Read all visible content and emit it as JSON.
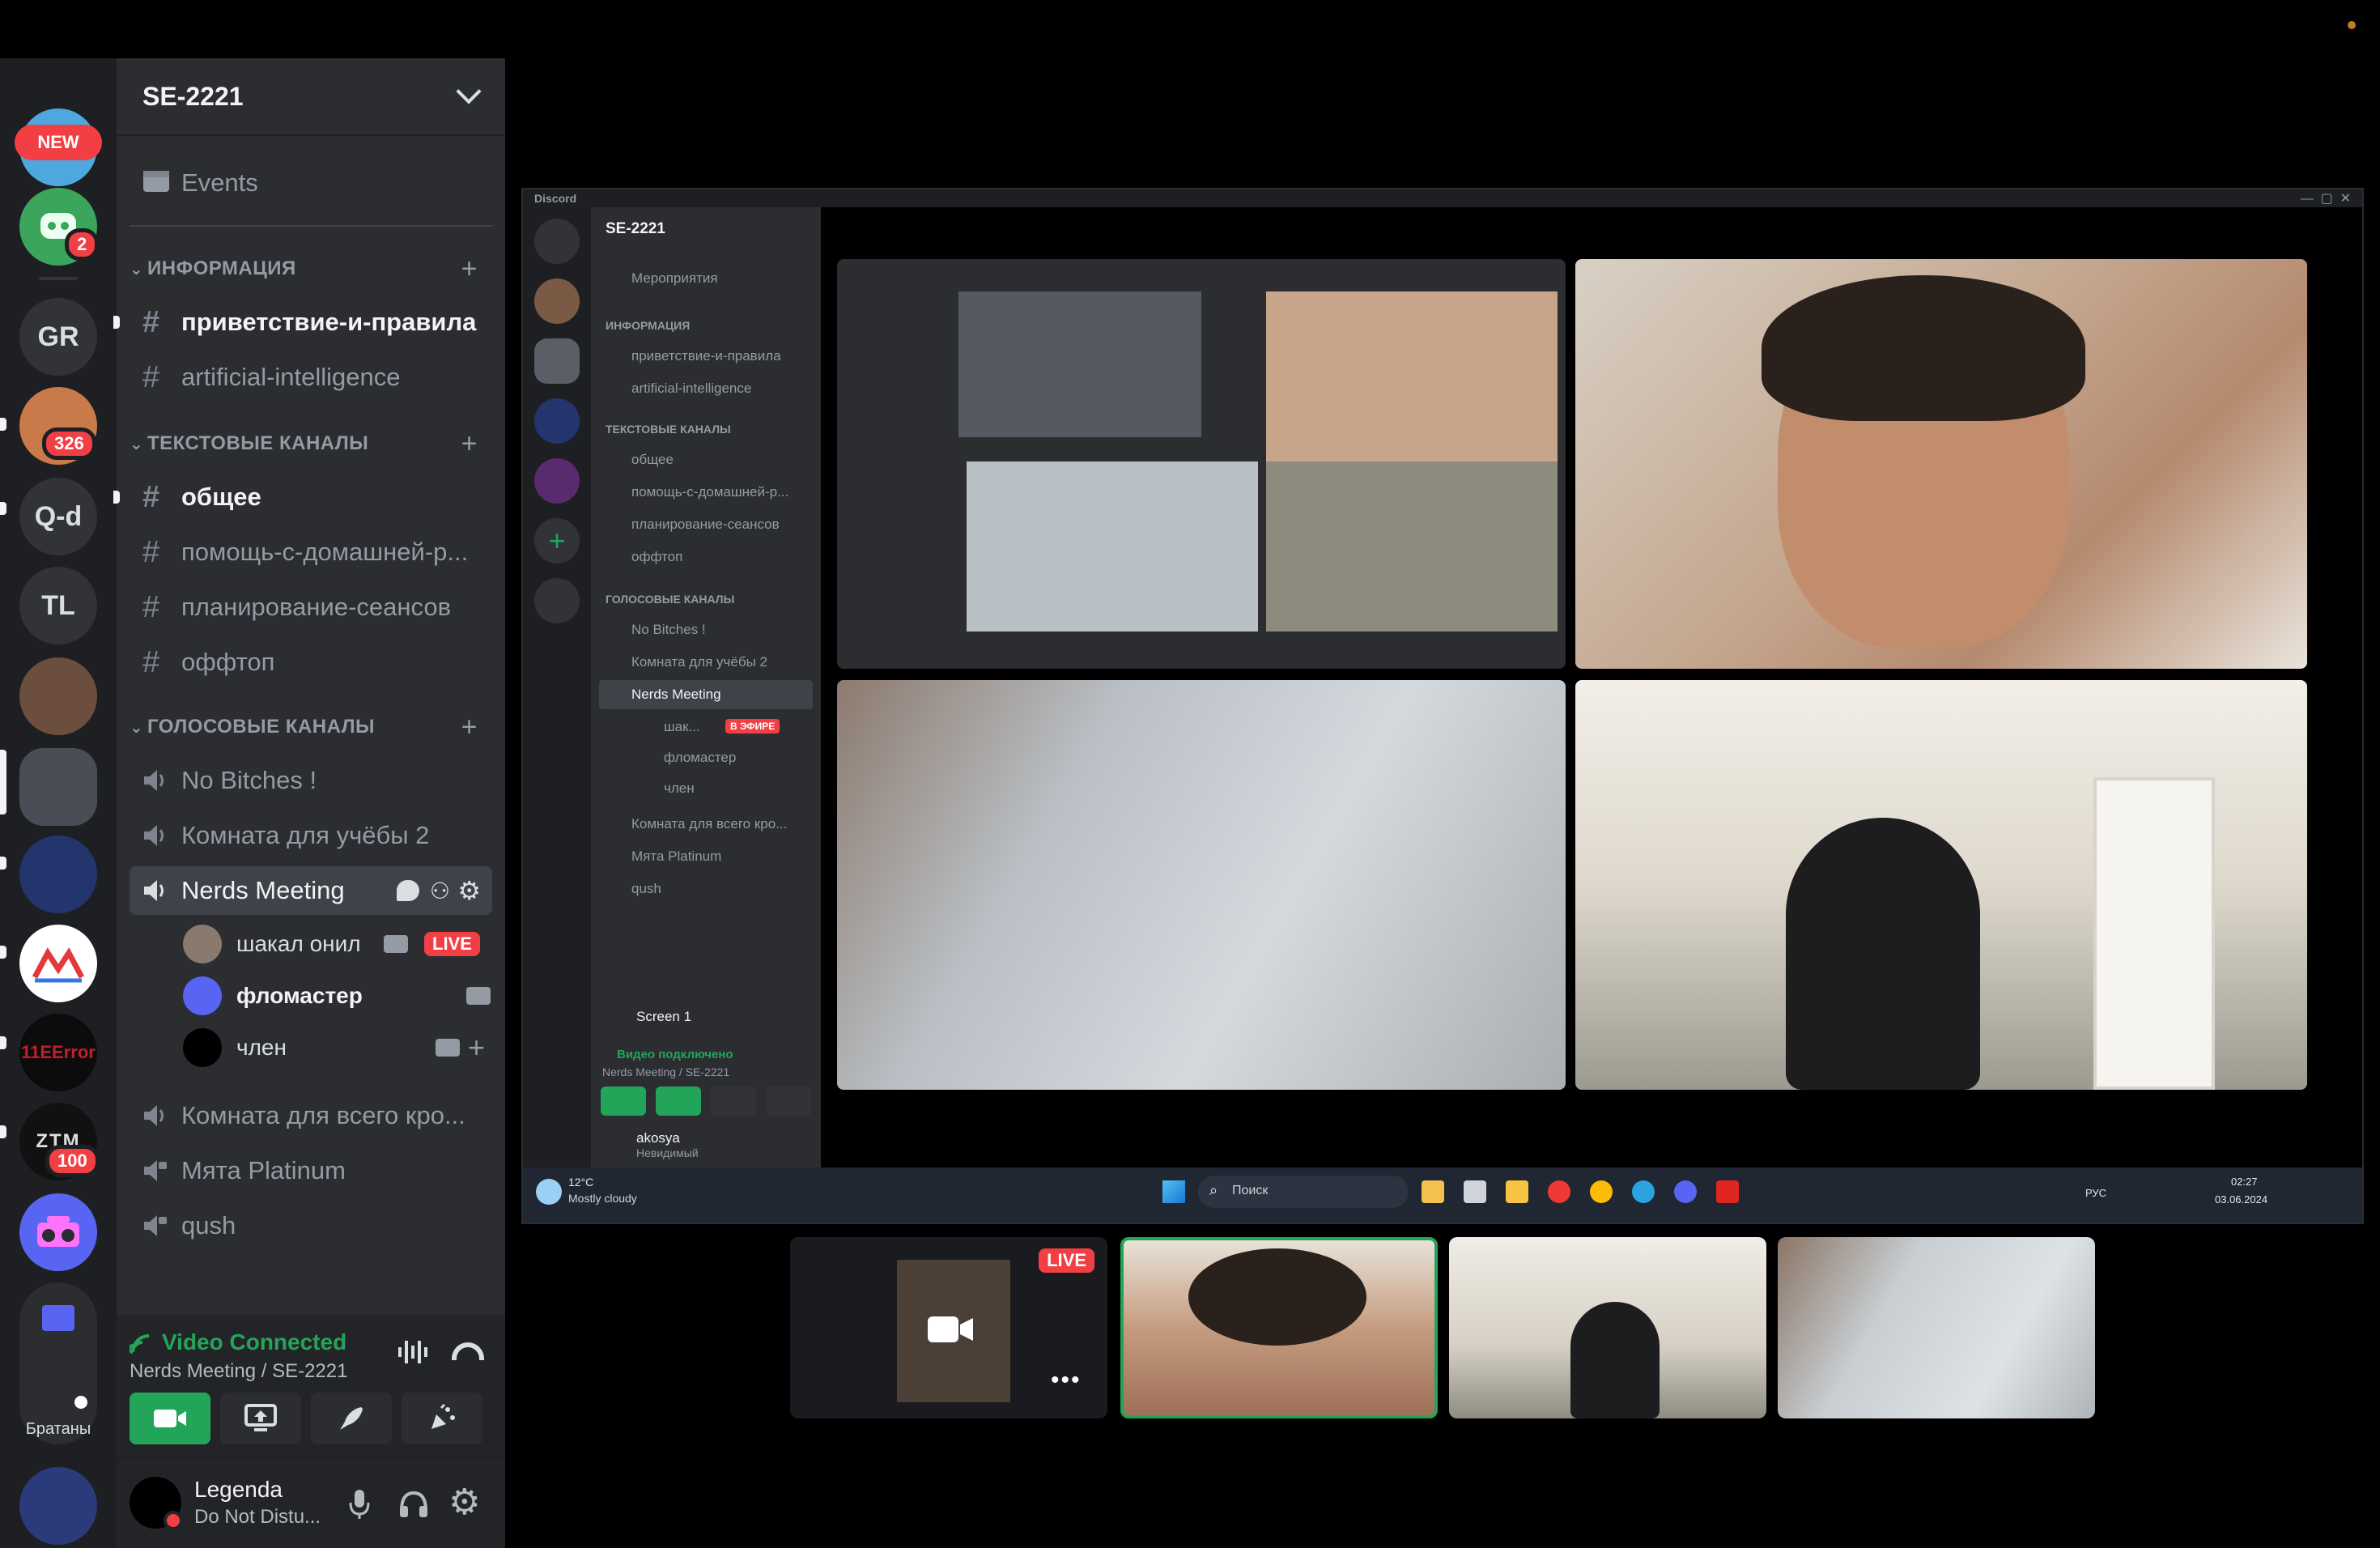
{
  "rail": {
    "new_label": "NEW",
    "servers": [
      {
        "name": "GR"
      },
      {
        "name": "Q-d"
      },
      {
        "name": "TL"
      }
    ],
    "badges": {
      "bot": "2",
      "anime": "326",
      "ztm": "100"
    },
    "folder_label": "Братаны"
  },
  "server": {
    "name": "SE-2221"
  },
  "sidebar": {
    "events_label": "Events",
    "categories": {
      "info": "ИНФОРМАЦИЯ",
      "text": "ТЕКСТОВЫЕ КАНАЛЫ",
      "voice": "ГОЛОСОВЫЕ КАНАЛЫ"
    },
    "info_channels": [
      "приветствие-и-правила",
      "artificial-intelligence"
    ],
    "text_channels": [
      "общее",
      "помощь-с-домашней-р...",
      "планирование-сеансов",
      "оффтоп"
    ],
    "voice_channels": [
      "No Bitches !",
      "Комната для учёбы 2",
      "Nerds Meeting",
      "Комната для всего кро...",
      "Мята Platinum",
      "qush"
    ],
    "voice_users": [
      "шакал онил",
      "фломастер",
      "член"
    ],
    "live_label": "LIVE"
  },
  "voice_panel": {
    "status": "Video Connected",
    "location": "Nerds Meeting / SE-2221"
  },
  "user": {
    "name": "Legenda",
    "status": "Do Not Distu..."
  },
  "inner": {
    "app_title": "Discord",
    "server_name": "SE-2221",
    "events": "Мероприятия",
    "cat_info": "ИНФОРМАЦИЯ",
    "cat_text": "ТЕКСТОВЫЕ КАНАЛЫ",
    "cat_voice": "ГОЛОСОВЫЕ КАНАЛЫ",
    "channels": [
      "приветствие-и-правила",
      "artificial-intelligence",
      "общее",
      "помощь-с-домашней-р...",
      "планирование-сеансов",
      "оффтоп"
    ],
    "voice": [
      "No Bitches !",
      "Комната для учёбы 2",
      "Nerds Meeting",
      "Комната для всего кро...",
      "Мята Platinum",
      "qush"
    ],
    "voice_users": [
      "шак...",
      "фломастер",
      "член"
    ],
    "live_label": "В ЭФИРЕ",
    "screen_label": "Screen 1",
    "video_status": "Видео подключено",
    "video_location": "Nerds Meeting / SE-2221",
    "user_name": "akosya",
    "user_status": "Невидимый",
    "taskbar_search": "Поиск",
    "weather_temp": "12°C",
    "weather_text": "Mostly cloudy",
    "lang": "РУС",
    "time": "02:27",
    "date": "03.06.2024"
  },
  "thumb_live_label": "LIVE",
  "colors": {
    "green": "#23a559",
    "red": "#f23f43",
    "blurple": "#5865f2"
  }
}
